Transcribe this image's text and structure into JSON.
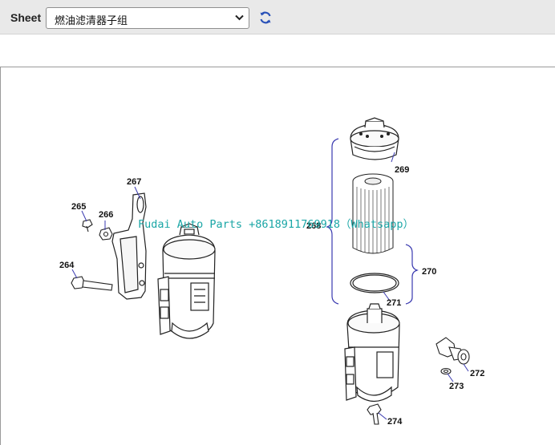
{
  "toolbar": {
    "sheet_label": "Sheet",
    "sheet_value": "燃油滤清器子组",
    "refresh_icon": "refresh-icon"
  },
  "diagram": {
    "callouts": {
      "c264": "264",
      "c265": "265",
      "c266": "266",
      "c267": "267",
      "c268": "268",
      "c269": "269",
      "c270": "270",
      "c271": "271",
      "c272": "272",
      "c273": "273",
      "c274": "274"
    },
    "watermark": "Fudai Auto Parts +8618911769918（Whatsapp）"
  },
  "colors": {
    "bracket": "#3a3ab0",
    "watermark": "#1aa6a6"
  }
}
